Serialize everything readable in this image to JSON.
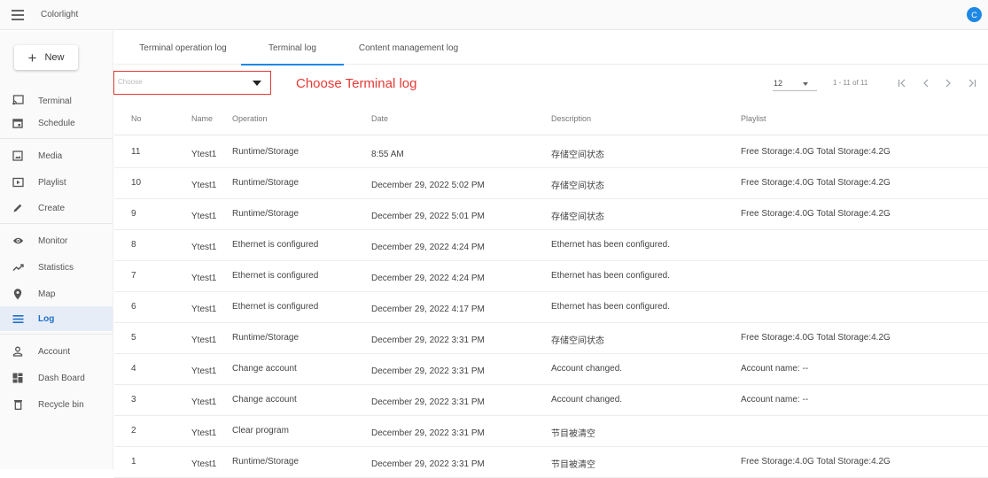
{
  "app": {
    "title": "Colorlight",
    "avatar_letter": "C"
  },
  "sidebar": {
    "new_label": "New",
    "items": [
      {
        "label": "Terminal",
        "icon": "cast-icon"
      },
      {
        "label": "Schedule",
        "icon": "calendar-icon"
      },
      {
        "label": "Media",
        "icon": "image-icon"
      },
      {
        "label": "Playlist",
        "icon": "playlist-icon"
      },
      {
        "label": "Create",
        "icon": "pencil-icon"
      },
      {
        "label": "Monitor",
        "icon": "eye-icon"
      },
      {
        "label": "Statistics",
        "icon": "trend-icon"
      },
      {
        "label": "Map",
        "icon": "map-pin-icon"
      },
      {
        "label": "Log",
        "icon": "list-icon",
        "active": true
      },
      {
        "label": "Account",
        "icon": "person-icon"
      },
      {
        "label": "Dash Board",
        "icon": "dashboard-icon"
      },
      {
        "label": "Recycle bin",
        "icon": "trash-icon"
      }
    ]
  },
  "tabs": [
    {
      "label": "Terminal operation log"
    },
    {
      "label": "Terminal log",
      "active": true
    },
    {
      "label": "Content management log"
    }
  ],
  "toolbar": {
    "choose_placeholder": "Choose",
    "annotation": "Choose Terminal log",
    "page_size": "12",
    "range": "1 - 11 of 11"
  },
  "table": {
    "headers": {
      "no": "No",
      "name": "Name",
      "operation": "Operation",
      "date": "Date",
      "description": "Description",
      "playlist": "Playlist"
    },
    "rows": [
      {
        "no": "11",
        "name": "Ytest1",
        "operation": "Runtime/Storage",
        "date": "8:55 AM",
        "description": "存储空间状态",
        "playlist": "Free Storage:4.0G Total Storage:4.2G"
      },
      {
        "no": "10",
        "name": "Ytest1",
        "operation": "Runtime/Storage",
        "date": "December 29, 2022 5:02 PM",
        "description": "存储空间状态",
        "playlist": "Free Storage:4.0G Total Storage:4.2G"
      },
      {
        "no": "9",
        "name": "Ytest1",
        "operation": "Runtime/Storage",
        "date": "December 29, 2022 5:01 PM",
        "description": "存储空间状态",
        "playlist": "Free Storage:4.0G Total Storage:4.2G"
      },
      {
        "no": "8",
        "name": "Ytest1",
        "operation": "Ethernet is configured",
        "date": "December 29, 2022 4:24 PM",
        "description": "Ethernet has been configured.",
        "playlist": ""
      },
      {
        "no": "7",
        "name": "Ytest1",
        "operation": "Ethernet is configured",
        "date": "December 29, 2022 4:24 PM",
        "description": "Ethernet has been configured.",
        "playlist": ""
      },
      {
        "no": "6",
        "name": "Ytest1",
        "operation": "Ethernet is configured",
        "date": "December 29, 2022 4:17 PM",
        "description": "Ethernet has been configured.",
        "playlist": ""
      },
      {
        "no": "5",
        "name": "Ytest1",
        "operation": "Runtime/Storage",
        "date": "December 29, 2022 3:31 PM",
        "description": "存储空间状态",
        "playlist": "Free Storage:4.0G Total Storage:4.2G"
      },
      {
        "no": "4",
        "name": "Ytest1",
        "operation": "Change account",
        "date": "December 29, 2022 3:31 PM",
        "description": "Account changed.",
        "playlist": "Account name: --"
      },
      {
        "no": "3",
        "name": "Ytest1",
        "operation": "Change account",
        "date": "December 29, 2022 3:31 PM",
        "description": "Account changed.",
        "playlist": "Account name: --"
      },
      {
        "no": "2",
        "name": "Ytest1",
        "operation": "Clear program",
        "date": "December 29, 2022 3:31 PM",
        "description": "节目被清空",
        "playlist": ""
      },
      {
        "no": "1",
        "name": "Ytest1",
        "operation": "Runtime/Storage",
        "date": "December 29, 2022 3:31 PM",
        "description": "节目被清空",
        "playlist": "Free Storage:4.0G Total Storage:4.2G"
      }
    ]
  },
  "colors": {
    "accent": "#1e88e5",
    "annotation": "#e53935",
    "active_bg": "#e7edf7"
  }
}
